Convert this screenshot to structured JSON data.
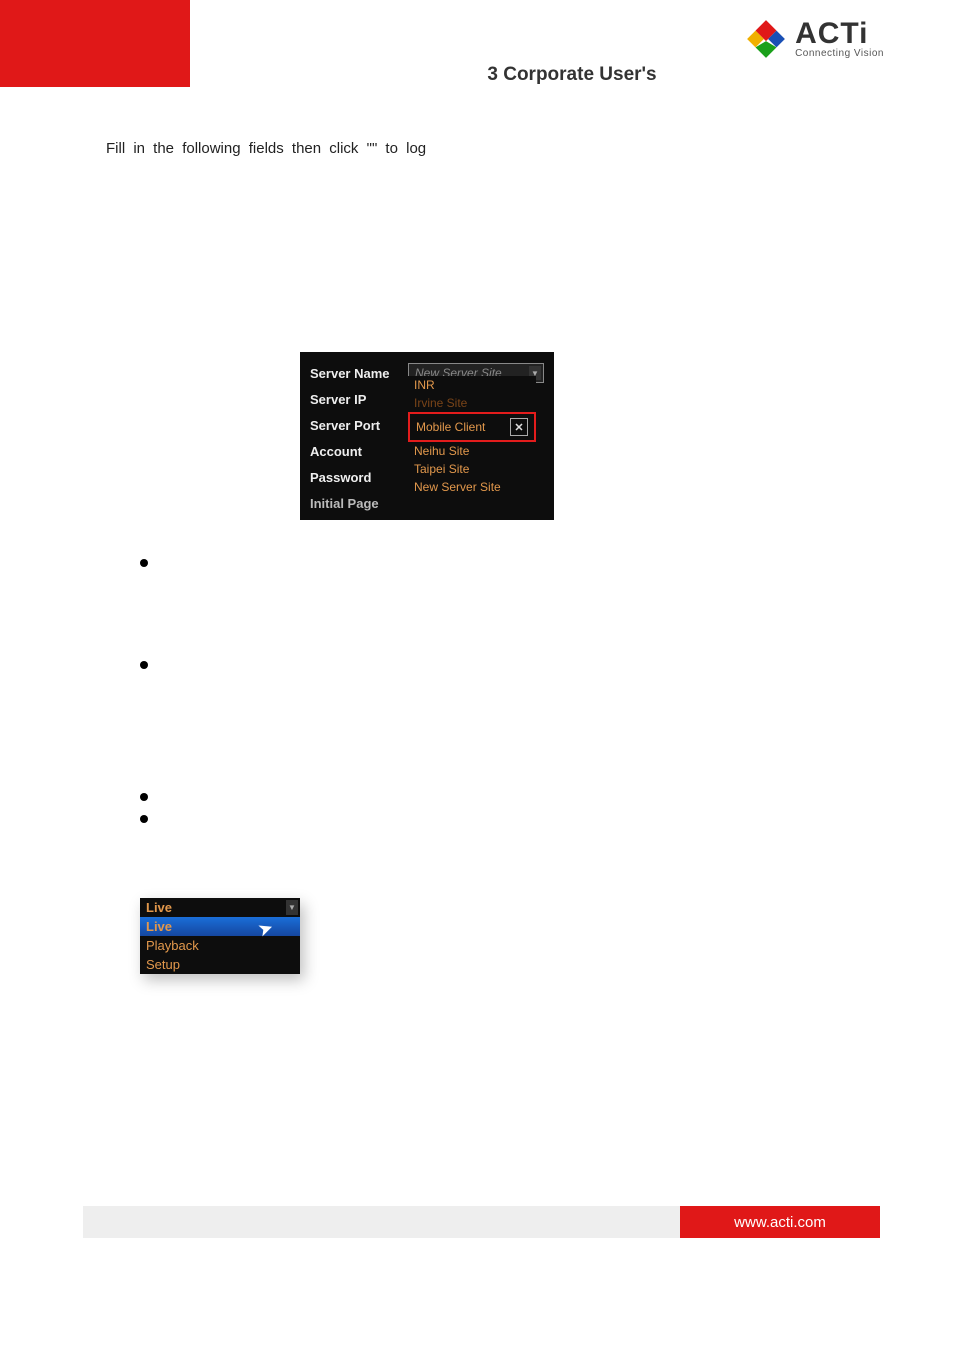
{
  "header": {
    "chapter_title": "3 Corporate User's",
    "brand": "ACTi",
    "brand_tag": "Connecting Vision"
  },
  "intro": {
    "line1_pre": "Fill  in  the  following  fields  then  click  \"",
    "line1_mid": "",
    "line1_post": "\"  to  log"
  },
  "dark_panel": {
    "labels": {
      "server_name": "Server Name",
      "server_ip": "Server IP",
      "server_port": "Server Port",
      "account": "Account",
      "password": "Password",
      "initial_page": "Initial Page"
    },
    "server_name_value": "New Server Site",
    "dropdown": {
      "item0": "INR",
      "item1": "Irvine Site",
      "item2": "Mobile Client",
      "item3": "Neihu Site",
      "item4": "Taipei Site",
      "item5": "New Server Site"
    }
  },
  "bullets": {
    "b1": "",
    "b2": "",
    "b3": "",
    "b4": ""
  },
  "live_panel": {
    "header": "Live",
    "sel": "Live",
    "opt1": "Playback",
    "opt2": "Setup"
  },
  "footer": {
    "url": "www.acti.com"
  }
}
